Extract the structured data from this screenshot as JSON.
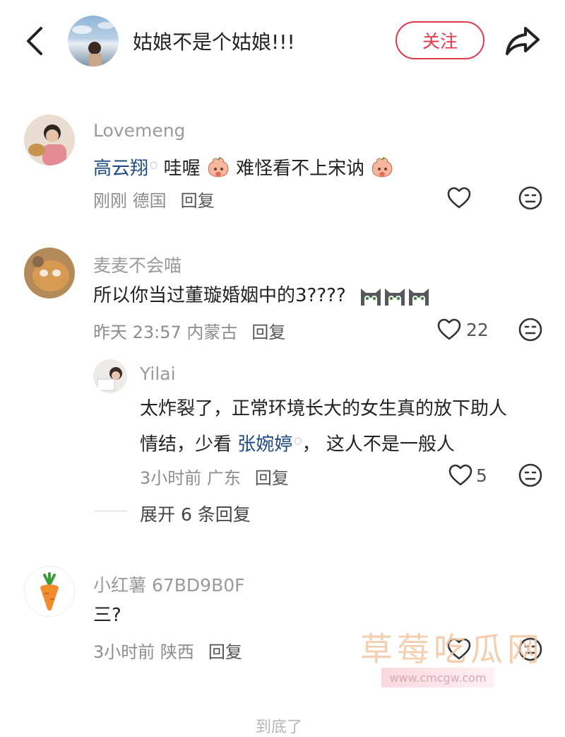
{
  "header": {
    "author_name": "姑娘不是个姑娘!!!",
    "follow_label": "关注"
  },
  "comments": [
    {
      "username": "Lovemeng",
      "text_mention": "高云翔",
      "text_part1": "哇喔",
      "text_part2": "难怪看不上宋讷",
      "time_location": "刚刚 德国",
      "reply_label": "回复"
    },
    {
      "username": "麦麦不会喵",
      "text": "所以你当过董璇婚姻中的3????",
      "time_location": "昨天 23:57 内蒙古",
      "reply_label": "回复",
      "likes": "22"
    },
    {
      "username": "小红薯 67BD9B0F",
      "text": "三?",
      "time_location": "3小时前 陕西",
      "reply_label": "回复"
    }
  ],
  "reply": {
    "username": "Yilai",
    "line1": "太炸裂了，正常环境长大的女生真的放下助人",
    "line2_start": "情结，少看 ",
    "mention": "张婉婷",
    "line2_end": "， 这人不是一般人",
    "time_location": "3小时前 广东",
    "reply_label": "回复",
    "likes": "5"
  },
  "expand_label": "展开 6 条回复",
  "watermark": {
    "text": "草莓吃瓜网",
    "url": "www.cmcgw.com"
  },
  "bottom_text": "到底了"
}
